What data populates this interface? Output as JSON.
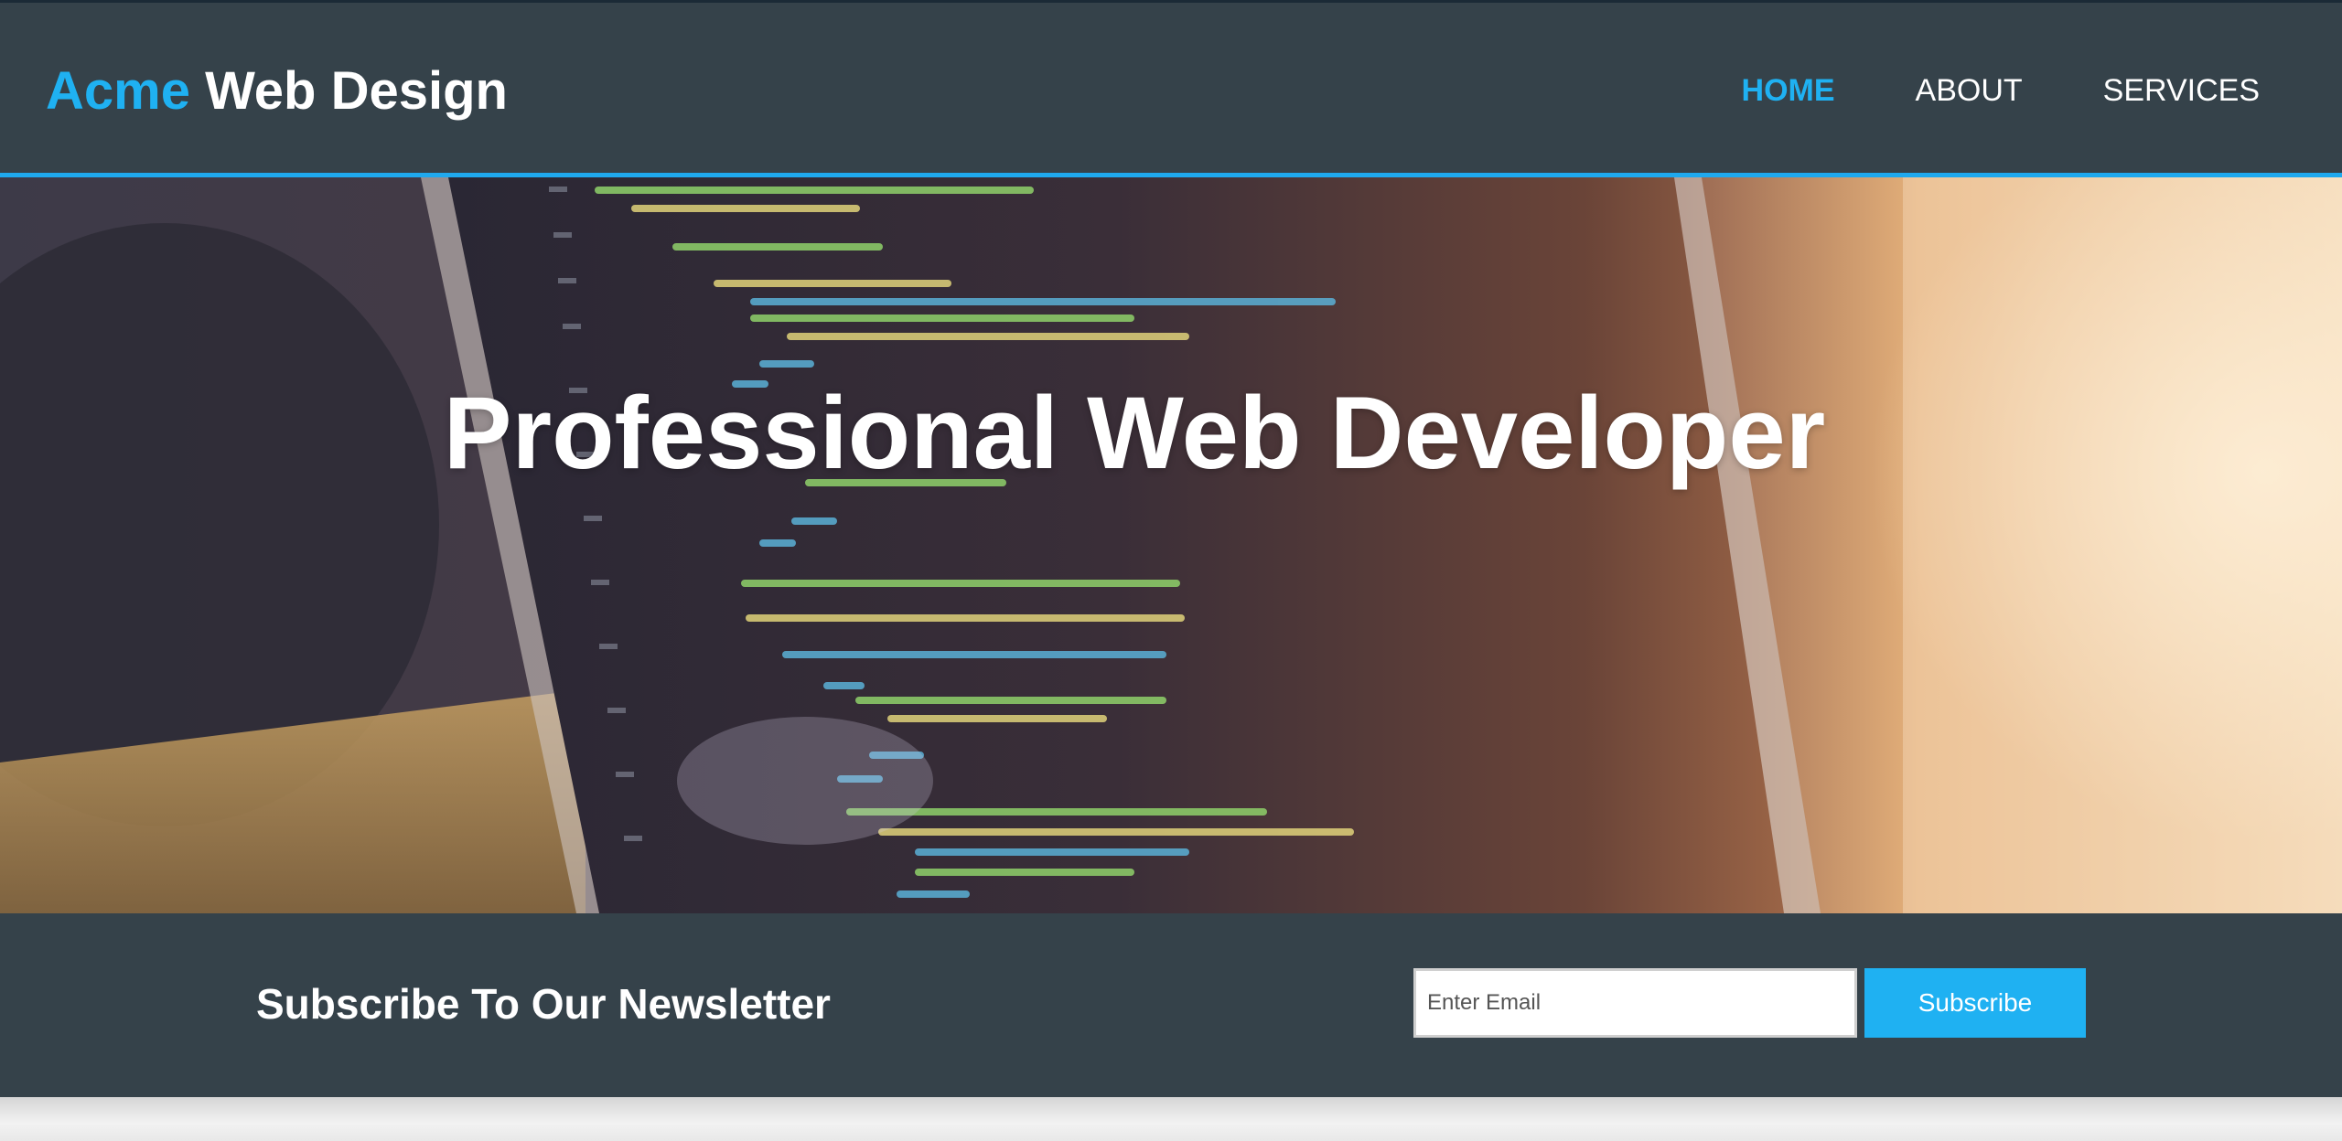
{
  "header": {
    "brand_highlight": "Acme",
    "brand_rest": " Web Design",
    "nav": [
      {
        "label": "HOME"
      },
      {
        "label": "ABOUT"
      },
      {
        "label": "SERVICES"
      }
    ]
  },
  "showcase": {
    "title": "Professional Web Developer"
  },
  "newsletter": {
    "heading": "Subscribe To Our Newsletter",
    "email_placeholder": "Enter Email",
    "email_value": "",
    "subscribe_label": "Subscribe"
  },
  "colors": {
    "header_bg": "#35424a",
    "accent": "#1fb1f2",
    "text_light": "#ffffff"
  }
}
